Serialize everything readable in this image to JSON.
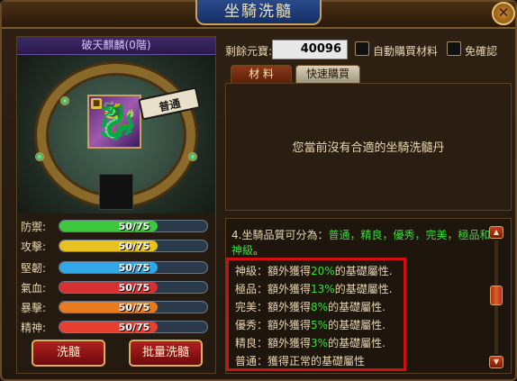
{
  "window": {
    "title": "坐騎洗髓",
    "close_glyph": "✕"
  },
  "mount": {
    "name": "破天麒麟(0階)",
    "quality_tag": "普通",
    "portrait_glyph": "🐉",
    "lock_glyph": "🔒"
  },
  "stats": [
    {
      "label": "防禦:",
      "value": "50/75",
      "fraction": 0.667,
      "color": "#3ec83e"
    },
    {
      "label": "攻擊:",
      "value": "50/75",
      "fraction": 0.667,
      "color": "#e8c020"
    },
    {
      "label": "堅韌:",
      "value": "50/75",
      "fraction": 0.667,
      "color": "#30a8e8"
    },
    {
      "label": "氣血:",
      "value": "50/75",
      "fraction": 0.667,
      "color": "#d83030"
    },
    {
      "label": "暴擊:",
      "value": "50/75",
      "fraction": 0.667,
      "color": "#e87a20"
    },
    {
      "label": "精神:",
      "value": "50/75",
      "fraction": 0.667,
      "color": "#e84030"
    }
  ],
  "buttons": {
    "refine": "洗髓",
    "batch_refine": "批量洗髓"
  },
  "currency": {
    "label": "剩餘元寶:",
    "value": "40096"
  },
  "options": {
    "auto_buy": "自動購買材料",
    "no_confirm": "免確認"
  },
  "tabs": {
    "materials": "材 料",
    "quick_buy": "快速購買"
  },
  "material_panel": {
    "empty_message": "您當前沒有合適的坐騎洗髓丹"
  },
  "info": {
    "intro_prefix": "4.坐騎品質可分為：",
    "intro_grades": "普通，精良，優秀，完美，極品和神級",
    "intro_suffix": "。",
    "lines": [
      {
        "grade": "神級：額外獲得",
        "pct": "20%",
        "tail": "的基礎屬性."
      },
      {
        "grade": "極品：額外獲得",
        "pct": "13%",
        "tail": "的基礎屬性."
      },
      {
        "grade": "完美：額外獲得",
        "pct": "8%",
        "tail": "的基礎屬性."
      },
      {
        "grade": "優秀：額外獲得",
        "pct": "5%",
        "tail": "的基礎屬性."
      },
      {
        "grade": "精良：額外獲得",
        "pct": "3%",
        "tail": "的基礎屬性."
      }
    ],
    "last_line": "普通：獲得正常的基礎屬性"
  },
  "scroll": {
    "up_glyph": "▲",
    "down_glyph": "▼"
  }
}
